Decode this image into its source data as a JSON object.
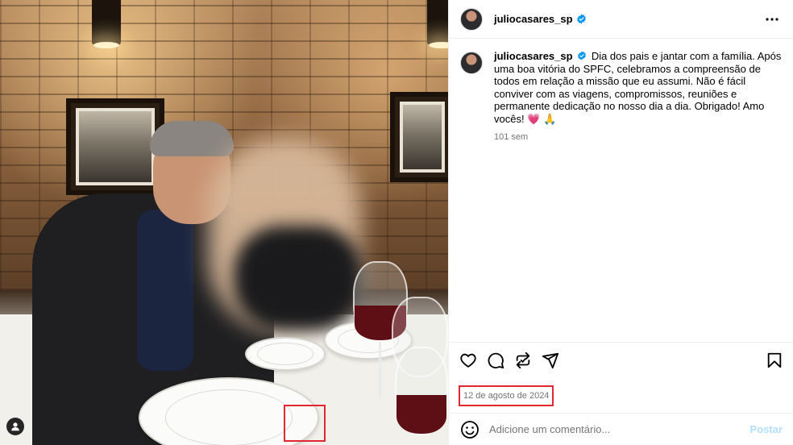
{
  "post": {
    "username": "juliocasares_sp",
    "verified": true,
    "caption_text": "Dia dos pais e jantar com a família. Após uma boa vitória do SPFC, celebramos a compreensão de todos em relação a missão que eu assumi. Não é fácil conviver com as viagens, compromissos, reuniões e permanente dedicação no nosso dia a dia. Obrigado! Amo vocês! 💗 🙏",
    "time_ago": "101 sem",
    "date": "12 de agosto de 2024"
  },
  "icons": {
    "header": [
      "verified-badge-icon",
      "more-options-icon"
    ],
    "actions": [
      "like-heart-icon",
      "comment-icon",
      "repost-icon",
      "share-icon",
      "save-bookmark-icon"
    ],
    "comment": [
      "emoji-icon"
    ],
    "photo": [
      "tagged-user-icon"
    ]
  },
  "comment_box": {
    "placeholder": "Adicione um comentário...",
    "post_label": "Postar"
  },
  "colors": {
    "verified": "#0095f6",
    "highlight_box": "#e0282e",
    "post_button_disabled": "#b2dffc",
    "secondary_text": "#737373"
  }
}
